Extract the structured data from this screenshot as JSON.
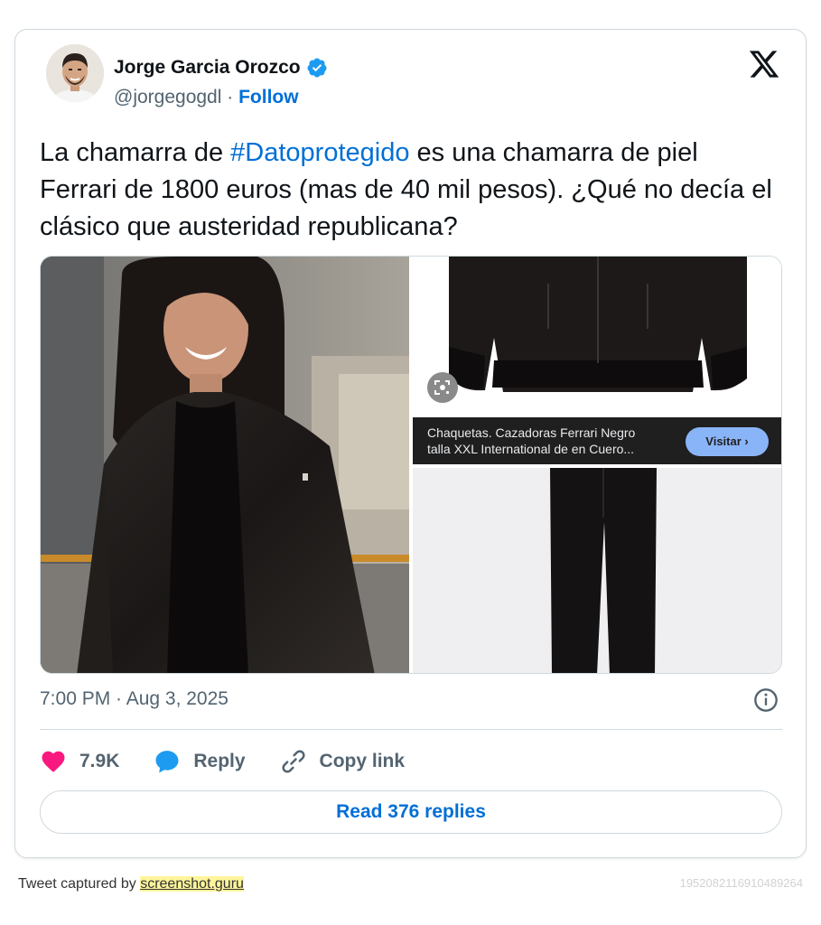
{
  "tweet": {
    "author_name": "Jorge Garcia Orozco",
    "handle": "@jorgegogdl",
    "separator": " · ",
    "follow_label": "Follow",
    "text_before": "La chamarra de ",
    "hashtag": "#Datoprotegido",
    "text_after": " es una chamarra de piel Ferrari de 1800 euros (mas de 40 mil pesos). ¿Qué no decía el clásico que austeridad republicana?",
    "timestamp": "7:00 PM · Aug 3, 2025",
    "likes_count": "7.9K",
    "reply_label": "Reply",
    "copy_link_label": "Copy link",
    "read_replies_label": "Read 376 replies"
  },
  "media": {
    "product_caption_line1": "Chaquetas. Cazadoras Ferrari Negro",
    "product_caption_line2": "talla XXL International de en Cuero...",
    "visit_label": "Visitar ›"
  },
  "footer": {
    "captured_prefix": "Tweet captured by ",
    "captured_link": "screenshot.guru",
    "tweet_id": "1952082116910489264"
  },
  "colors": {
    "link_blue": "#006fd6",
    "text_primary": "#0f1419",
    "text_secondary": "#536471",
    "like_pink": "#f91880",
    "reply_blue": "#1d9bf0",
    "verified_blue": "#1d9bf0",
    "border": "#cfd9de"
  },
  "icons": {
    "verified": "verified-badge-icon",
    "brand": "x-logo-icon",
    "info": "info-icon",
    "like": "heart-icon",
    "reply": "speech-bubble-icon",
    "copy_link": "link-icon",
    "lens": "google-lens-icon"
  }
}
